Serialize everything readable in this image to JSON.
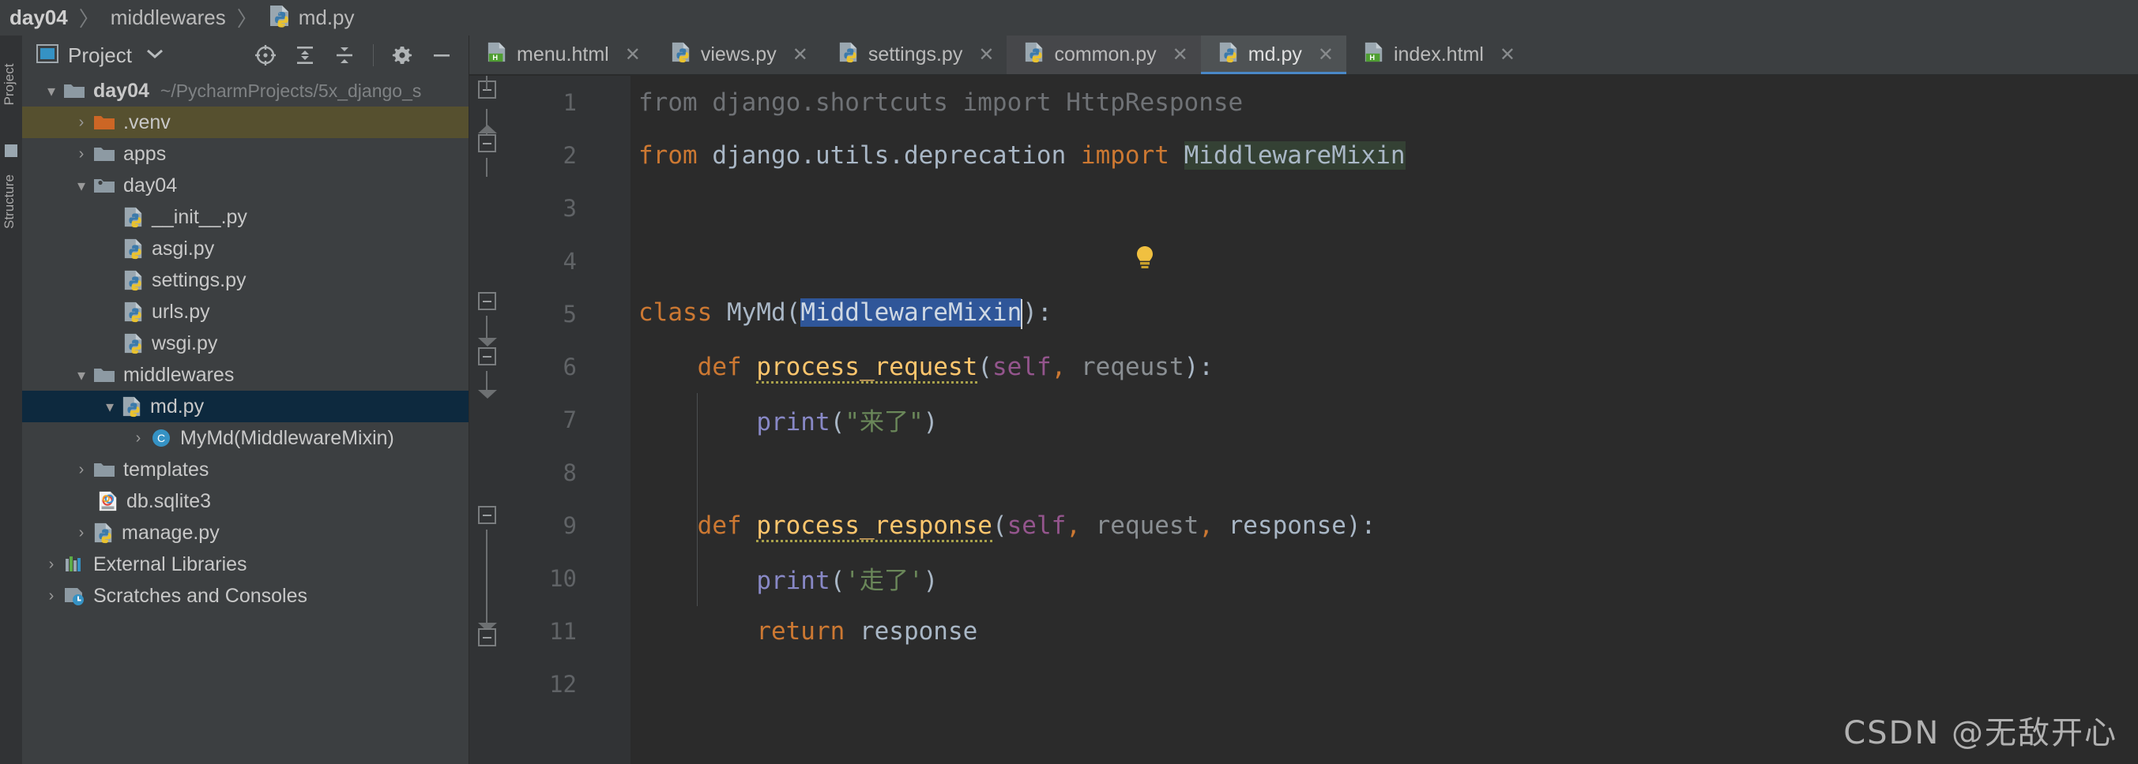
{
  "breadcrumb": {
    "items": [
      {
        "label": "day04",
        "bold": true,
        "icon": "none"
      },
      {
        "label": "middlewares",
        "bold": false,
        "icon": "none"
      },
      {
        "label": "md.py",
        "bold": false,
        "icon": "python-file-icon"
      }
    ],
    "separator": "〉"
  },
  "left_strip": {
    "project_label": "Project",
    "structure_label": "Structure"
  },
  "project_panel": {
    "title": "Project",
    "caret": "▾",
    "tools": [
      {
        "name": "select-opened-file-icon",
        "label": "Select Opened File"
      },
      {
        "name": "expand-all-icon",
        "label": "Expand All"
      },
      {
        "name": "collapse-all-icon",
        "label": "Collapse All"
      },
      {
        "name": "settings-gear-icon",
        "label": "Settings"
      },
      {
        "name": "hide-panel-icon",
        "label": "Hide"
      }
    ],
    "tree": [
      {
        "label": "day04",
        "sublabel": "~/PycharmProjects/5x_django_s",
        "icon": "folder-icon",
        "arrow": "⌄",
        "indent": 0,
        "bold": true,
        "state": "normal"
      },
      {
        "label": ".venv",
        "sublabel": "",
        "icon": "folder-orange-icon",
        "arrow": "›",
        "indent": 1,
        "bold": false,
        "state": "excluded"
      },
      {
        "label": "apps",
        "sublabel": "",
        "icon": "folder-icon",
        "arrow": "›",
        "indent": 1,
        "bold": false,
        "state": "normal"
      },
      {
        "label": "day04",
        "sublabel": "",
        "icon": "folder-package-icon",
        "arrow": "⌄",
        "indent": 1,
        "bold": false,
        "state": "normal"
      },
      {
        "label": "__init__.py",
        "sublabel": "",
        "icon": "python-file-icon",
        "arrow": "",
        "indent": 2,
        "bold": false,
        "state": "normal"
      },
      {
        "label": "asgi.py",
        "sublabel": "",
        "icon": "python-file-icon",
        "arrow": "",
        "indent": 2,
        "bold": false,
        "state": "normal"
      },
      {
        "label": "settings.py",
        "sublabel": "",
        "icon": "python-file-icon",
        "arrow": "",
        "indent": 2,
        "bold": false,
        "state": "normal"
      },
      {
        "label": "urls.py",
        "sublabel": "",
        "icon": "python-file-icon",
        "arrow": "",
        "indent": 2,
        "bold": false,
        "state": "normal"
      },
      {
        "label": "wsgi.py",
        "sublabel": "",
        "icon": "python-file-icon",
        "arrow": "",
        "indent": 2,
        "bold": false,
        "state": "normal"
      },
      {
        "label": "middlewares",
        "sublabel": "",
        "icon": "folder-icon",
        "arrow": "⌄",
        "indent": 1,
        "bold": false,
        "state": "normal"
      },
      {
        "label": "md.py",
        "sublabel": "",
        "icon": "python-file-icon",
        "arrow": "⌄",
        "indent": 2,
        "bold": false,
        "state": "selected"
      },
      {
        "label": "MyMd(MiddlewareMixin)",
        "sublabel": "",
        "icon": "class-icon",
        "arrow": "›",
        "indent": 3,
        "bold": false,
        "state": "normal"
      },
      {
        "label": "templates",
        "sublabel": "",
        "icon": "folder-icon",
        "arrow": "›",
        "indent": 1,
        "bold": false,
        "state": "normal"
      },
      {
        "label": "db.sqlite3",
        "sublabel": "",
        "icon": "sqlite-file-icon",
        "arrow": "",
        "indent": 1,
        "bold": false,
        "state": "normal"
      },
      {
        "label": "manage.py",
        "sublabel": "",
        "icon": "python-file-icon",
        "arrow": "›",
        "indent": 1,
        "bold": false,
        "state": "normal"
      },
      {
        "label": "External Libraries",
        "sublabel": "",
        "icon": "external-libraries-icon",
        "arrow": "›",
        "indent": 0,
        "bold": false,
        "state": "normal"
      },
      {
        "label": "Scratches and Consoles",
        "sublabel": "",
        "icon": "scratches-icon",
        "arrow": "›",
        "indent": 0,
        "bold": false,
        "state": "normal"
      }
    ]
  },
  "editor": {
    "tabs": [
      {
        "label": "menu.html",
        "icon": "html-file-icon",
        "state": "normal",
        "close": "✕"
      },
      {
        "label": "views.py",
        "icon": "python-file-icon",
        "state": "normal",
        "close": "✕"
      },
      {
        "label": "settings.py",
        "icon": "python-file-icon",
        "state": "normal",
        "close": "✕"
      },
      {
        "label": "common.py",
        "icon": "python-file-icon",
        "state": "previous",
        "close": "✕"
      },
      {
        "label": "md.py",
        "icon": "python-file-icon",
        "state": "active",
        "close": "✕"
      },
      {
        "label": "index.html",
        "icon": "html-file-icon",
        "state": "normal",
        "close": "✕"
      }
    ],
    "line_numbers": [
      "1",
      "2",
      "3",
      "4",
      "5",
      "6",
      "7",
      "8",
      "9",
      "10",
      "11",
      "12"
    ],
    "lines": [
      {
        "n": "1",
        "tokens": [
          {
            "t": "from django.shortcuts import HttpResponse",
            "c": "dim"
          }
        ]
      },
      {
        "n": "2",
        "tokens": [
          {
            "t": "from",
            "c": "k"
          },
          {
            "t": " django.utils.deprecation ",
            "c": "par"
          },
          {
            "t": "import",
            "c": "k"
          },
          {
            "t": " ",
            "c": "par"
          },
          {
            "t": "MiddlewareMixin",
            "c": "hl-green"
          }
        ]
      },
      {
        "n": "3",
        "tokens": []
      },
      {
        "n": "4",
        "tokens": []
      },
      {
        "n": "5",
        "tokens": [
          {
            "t": "class",
            "c": "k"
          },
          {
            "t": " MyMd(",
            "c": "par"
          },
          {
            "t": "MiddlewareMixin",
            "c": "hl-sel"
          },
          {
            "t": "caret",
            "c": "caret"
          },
          {
            "t": "):",
            "c": "par"
          }
        ]
      },
      {
        "n": "6",
        "tokens": [
          {
            "t": "    ",
            "c": "par"
          },
          {
            "t": "def",
            "c": "k"
          },
          {
            "t": " ",
            "c": "par"
          },
          {
            "t": "process_request",
            "c": "fnw"
          },
          {
            "t": "(",
            "c": "par"
          },
          {
            "t": "self",
            "c": "slf"
          },
          {
            "t": ",",
            "c": "k"
          },
          {
            "t": " reqeust",
            "c": "prm"
          },
          {
            "t": "):",
            "c": "par"
          }
        ]
      },
      {
        "n": "7",
        "tokens": [
          {
            "t": "        ",
            "c": "par"
          },
          {
            "t": "print",
            "c": "bi"
          },
          {
            "t": "(",
            "c": "par"
          },
          {
            "t": "\"来了\"",
            "c": "str"
          },
          {
            "t": ")",
            "c": "par"
          }
        ]
      },
      {
        "n": "8",
        "tokens": []
      },
      {
        "n": "9",
        "tokens": [
          {
            "t": "    ",
            "c": "par"
          },
          {
            "t": "def",
            "c": "k"
          },
          {
            "t": " ",
            "c": "par"
          },
          {
            "t": "process_response",
            "c": "fnw"
          },
          {
            "t": "(",
            "c": "par"
          },
          {
            "t": "self",
            "c": "slf"
          },
          {
            "t": ",",
            "c": "k"
          },
          {
            "t": " request",
            "c": "prm"
          },
          {
            "t": ",",
            "c": "k"
          },
          {
            "t": " response",
            "c": "par"
          },
          {
            "t": "):",
            "c": "par"
          }
        ]
      },
      {
        "n": "10",
        "tokens": [
          {
            "t": "        ",
            "c": "par"
          },
          {
            "t": "print",
            "c": "bi"
          },
          {
            "t": "(",
            "c": "par"
          },
          {
            "t": "'走了'",
            "c": "str"
          },
          {
            "t": ")",
            "c": "par"
          }
        ]
      },
      {
        "n": "11",
        "tokens": [
          {
            "t": "        ",
            "c": "par"
          },
          {
            "t": "return",
            "c": "k"
          },
          {
            "t": " response",
            "c": "par"
          }
        ]
      },
      {
        "n": "12",
        "tokens": []
      }
    ],
    "intention_bulb": "intention-bulb-icon"
  },
  "watermark": "CSDN @无敌开心",
  "colors": {
    "bg_panel": "#3c3f41",
    "bg_editor": "#2b2b2b",
    "gutter": "#313335",
    "keyword": "#cc7832",
    "function": "#ffc66d",
    "string": "#6a8759",
    "self": "#94558d",
    "builtin": "#8888c6",
    "default_text": "#a9b7c6",
    "selection": "#2f5699",
    "usage_highlight": "#344134",
    "excluded_row": "#56502f",
    "selected_row": "#0d293e",
    "tab_underline": "#4a88c7"
  }
}
